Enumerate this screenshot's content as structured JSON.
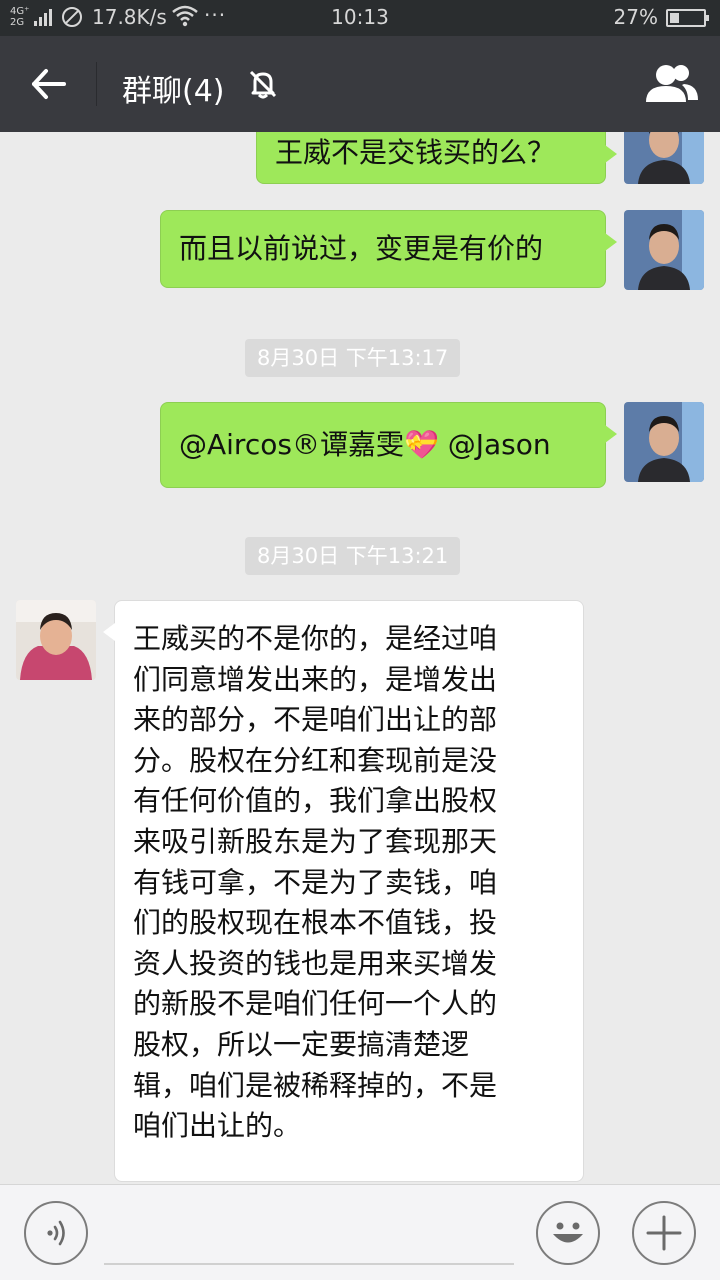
{
  "status_bar": {
    "network": "4G⁺ 2G",
    "speed": "17.8K/s",
    "wifi_icon": "wifi-icon",
    "dots": "···",
    "time": "10:13",
    "battery": "27%"
  },
  "header": {
    "title": "群聊(4)",
    "back_icon": "arrow-left-icon",
    "mute_icon": "bell-muted-icon",
    "group_icon": "group-members-icon",
    "background": "#393a3f"
  },
  "messages": [
    {
      "sender": "me",
      "text": "王威不是交钱买的么？"
    },
    {
      "sender": "me",
      "text": "而且以前说过，变更是有价的"
    },
    {
      "type": "time",
      "text": "8月30日 下午13:17"
    },
    {
      "sender": "me",
      "text": "@Aircos®谭嘉雯💝 @Jason"
    },
    {
      "type": "time",
      "text": "8月30日 下午13:21"
    },
    {
      "sender": "them",
      "lines": [
        "王威买的不是你的，是经过咱",
        "们同意增发出来的，是增发出",
        "来的部分，不是咱们出让的部",
        "分。股权在分红和套现前是没",
        "有任何价值的，我们拿出股权",
        "来吸引新股东是为了套现那天",
        "有钱可拿，不是为了卖钱，咱",
        "们的股权现在根本不值钱，投",
        "资人投资的钱也是用来买增发",
        "的新股不是咱们任何一个人的",
        "股权，所以一定要搞清楚逻",
        "辑，咱们是被稀释掉的，不是",
        "咱们出让的。"
      ]
    }
  ],
  "input_bar": {
    "voice_icon": "voice-icon",
    "emoji_icon": "emoji-icon",
    "plus_icon": "plus-icon"
  },
  "colors": {
    "my_bubble": "#9ee85a",
    "their_bubble": "#ffffff",
    "chat_bg": "#ebebeb"
  }
}
